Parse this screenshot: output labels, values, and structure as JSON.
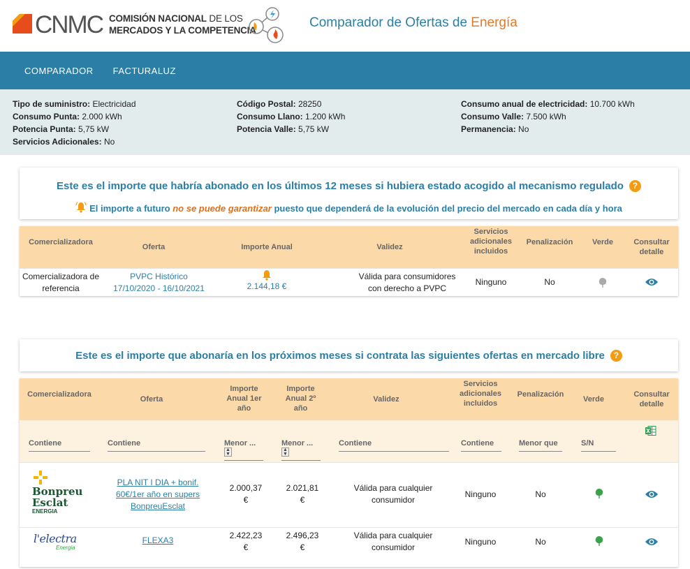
{
  "header": {
    "cnmc": "CNMC",
    "org_line1_bold": "COMISIÓN NACIONAL",
    "org_line1_thin": " DE LOS",
    "org_line2": "MERCADOS Y LA COMPETENCIA",
    "title_main": "Comparador de Ofertas de ",
    "title_accent": "Energía"
  },
  "nav": {
    "items": [
      "COMPARADOR",
      "FACTURALUZ"
    ]
  },
  "summary": {
    "tipo_label": "Tipo de suministro:",
    "tipo_value": " Electricidad",
    "cp_label": "Código Postal:",
    "cp_value": " 28250",
    "anual_label": "Consumo anual de electricidad:",
    "anual_value": " 10.700 kWh",
    "punta_label": "Consumo Punta:",
    "punta_value": " 2.000 kWh",
    "llano_label": "Consumo Llano:",
    "llano_value": " 1.200 kWh",
    "valle_label": "Consumo Valle:",
    "valle_value": " 7.500 kWh",
    "pot_punta_label": "Potencia Punta:",
    "pot_punta_value": " 5,75 kW",
    "pot_valle_label": "Potencia Valle:",
    "pot_valle_value": " 5,75 kW",
    "perm_label": "Permanencia:",
    "perm_value": " No",
    "serv_label": "Servicios Adicionales:",
    "serv_value": " No"
  },
  "regulated": {
    "title": "Este es el importe que habría abonado en los últimos 12 meses si hubiera estado acogido al mecanismo regulado",
    "notice_a": "El importe a futuro ",
    "notice_warn": "no se puede garantizar",
    "notice_b": " puesto que dependerá de la evolución del precio del mercado en cada día y hora",
    "headers": {
      "comercializadora": "Comercializadora",
      "oferta": "Oferta",
      "importe": "Importe Anual",
      "validez": "Validez",
      "servicios": "Servicios adicionales incluidos",
      "penalizacion": "Penalización",
      "verde": "Verde",
      "consultar": "Consultar detalle"
    },
    "row": {
      "comercializadora": "Comercializadora de referencia",
      "oferta_name": "PVPC Histórico",
      "oferta_dates": "17/10/2020 - 16/10/2021",
      "importe": "2.144,18 €",
      "validez": "Válida para consumidores con derecho a PVPC",
      "servicios": "Ninguno",
      "penalizacion": "No"
    }
  },
  "free": {
    "title": "Este es el importe que abonaría en los próximos meses si contrata las siguientes ofertas en mercado libre",
    "headers": {
      "comercializadora": "Comercializadora",
      "oferta": "Oferta",
      "importe1": "Importe Anual 1er año",
      "importe2": "Importe Anual 2º año",
      "validez": "Validez",
      "servicios": "Servicios adicionales incluidos",
      "penalizacion": "Penalización",
      "verde": "Verde",
      "consultar": "Consultar detalle"
    },
    "filters": {
      "comercializadora": "Contiene",
      "oferta": "Contiene",
      "importe1": "Menor ...",
      "importe2": "Menor ...",
      "validez": "Contiene",
      "servicios": "Contiene",
      "penalizacion": "Menor que",
      "verde": "S/N"
    },
    "rows": [
      {
        "logo_l1": "Bonpreu",
        "logo_l2": "Esclat",
        "logo_l3": "ENERGIA",
        "oferta": "PLA NIT I DIA + bonif. 60€/1er año en supers BonpreuEsclat",
        "imp1": "2.000,37",
        "imp2": "2.021,81",
        "cur": "€",
        "validez": "Válida para cualquier consumidor",
        "servicios": "Ninguno",
        "penalizacion": "No"
      },
      {
        "logo_l1": "l'electra",
        "logo_l2": "Energia",
        "oferta": "FLEXA3",
        "imp1": "2.422,23",
        "imp2": "2.496,23",
        "cur": "€",
        "validez": "Válida para cualquier consumidor",
        "servicios": "Ninguno",
        "penalizacion": "No"
      }
    ]
  }
}
